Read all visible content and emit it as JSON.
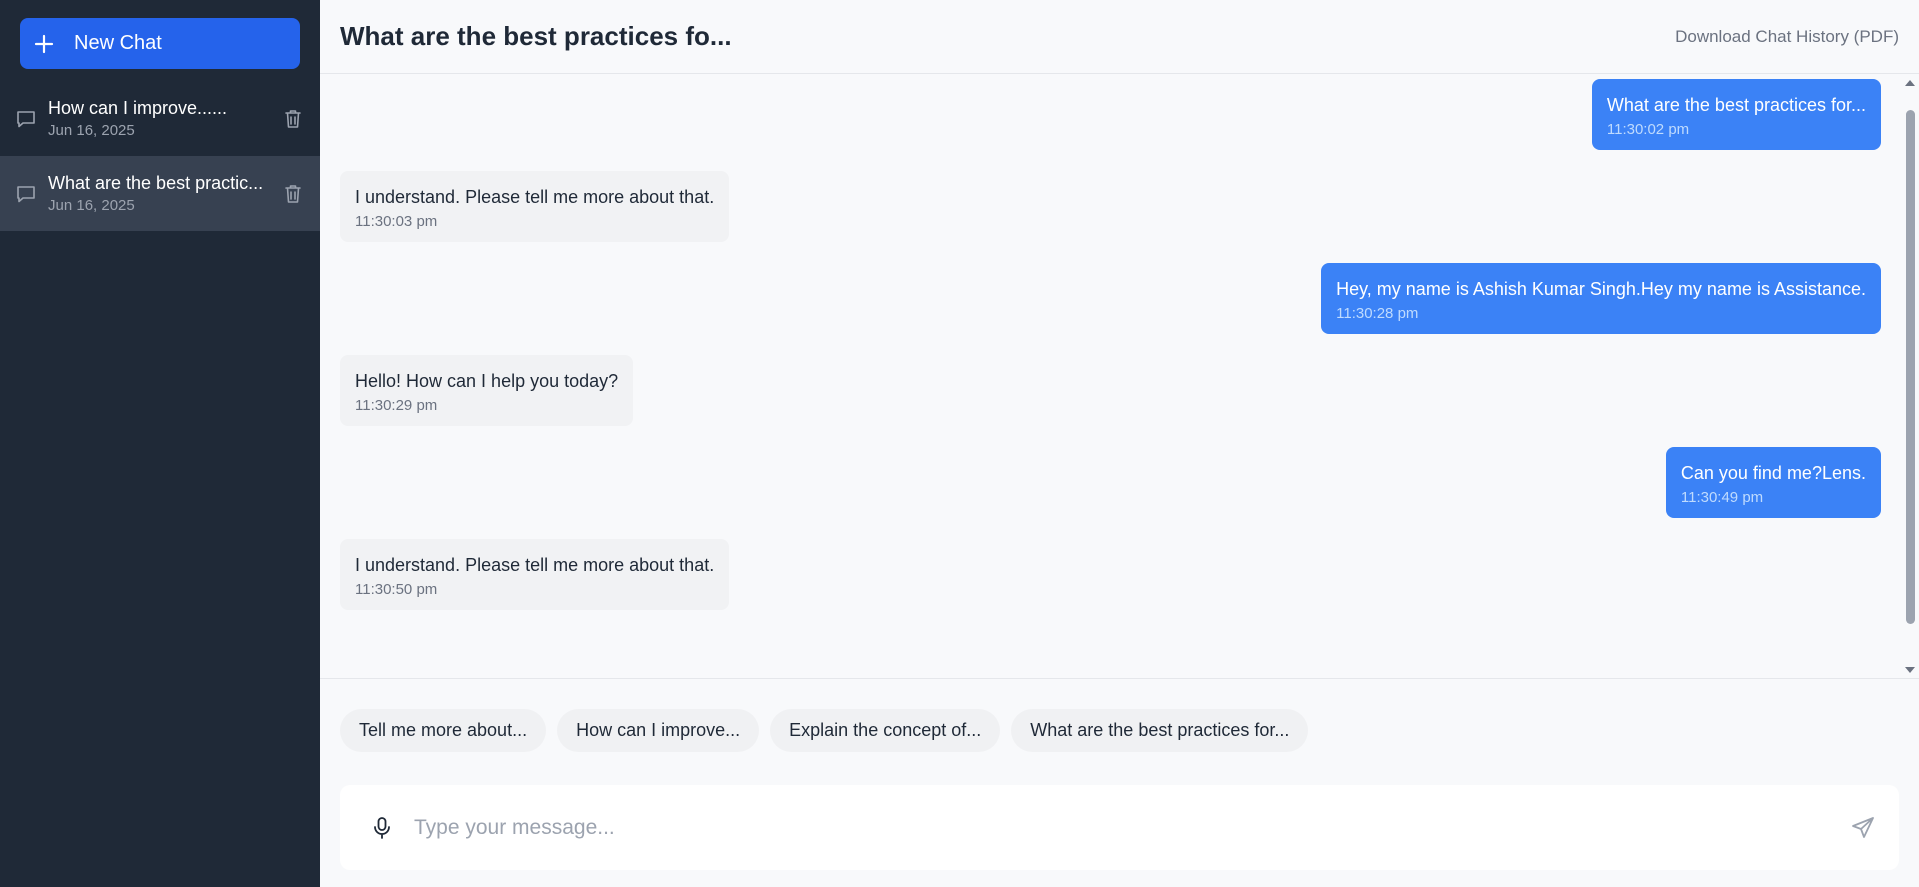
{
  "sidebar": {
    "new_chat_label": "New Chat",
    "chats": [
      {
        "title": "How can I improve......",
        "date": "Jun 16, 2025",
        "active": false
      },
      {
        "title": "What are the best practic...",
        "date": "Jun 16, 2025",
        "active": true
      }
    ]
  },
  "header": {
    "title": "What are the best practices fo...",
    "download_label": "Download Chat History (PDF)"
  },
  "messages": [
    {
      "role": "user",
      "text": "What are the best practices for...",
      "time": "11:30:02 pm"
    },
    {
      "role": "bot",
      "text": "I understand. Please tell me more about that.",
      "time": "11:30:03 pm"
    },
    {
      "role": "user",
      "text": "Hey, my name is Ashish Kumar Singh.Hey my name is Assistance.",
      "time": "11:30:28 pm"
    },
    {
      "role": "bot",
      "text": "Hello! How can I help you today?",
      "time": "11:30:29 pm"
    },
    {
      "role": "user",
      "text": "Can you find me?Lens.",
      "time": "11:30:49 pm"
    },
    {
      "role": "bot",
      "text": "I understand. Please tell me more about that.",
      "time": "11:30:50 pm"
    }
  ],
  "suggestions": [
    "Tell me more about...",
    "How can I improve...",
    "Explain the concept of...",
    "What are the best practices for..."
  ],
  "composer": {
    "placeholder": "Type your message..."
  },
  "colors": {
    "sidebar_bg": "#1f2937",
    "accent": "#2563eb",
    "user_bubble": "#3b82f6",
    "bot_bubble": "#f1f2f4"
  },
  "icons": {
    "new_chat": "plus-icon",
    "chat_item": "chat-bubble-icon",
    "delete": "trash-icon",
    "mic": "microphone-icon",
    "send": "send-icon"
  }
}
